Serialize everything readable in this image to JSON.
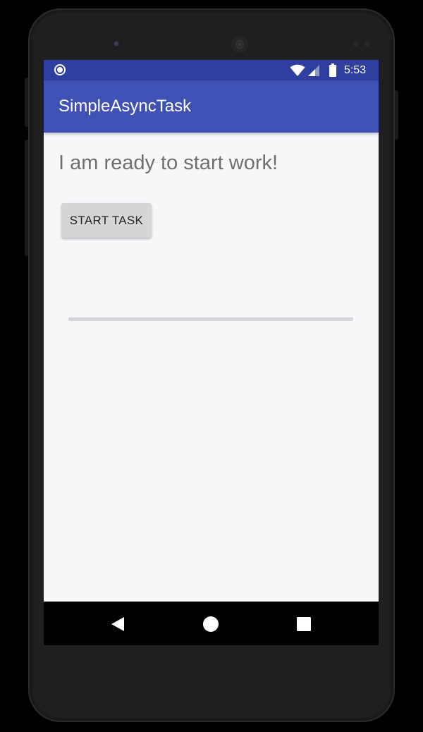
{
  "status_bar": {
    "time": "5:53",
    "icons": [
      "sync-circle-icon",
      "wifi-icon",
      "cell-signal-icon",
      "battery-icon"
    ],
    "color": "#303f9f"
  },
  "app_bar": {
    "title": "SimpleAsyncTask",
    "color": "#3f51b5"
  },
  "content": {
    "message": "I am ready to start work!",
    "start_button_label": "START TASK",
    "progress": 0
  },
  "nav_bar": {
    "buttons": [
      "back-icon",
      "home-icon",
      "recents-icon"
    ]
  }
}
